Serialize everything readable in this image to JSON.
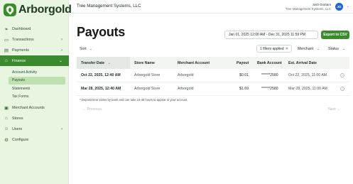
{
  "brand": {
    "name": "Arborgold"
  },
  "sidebar": {
    "items": [
      {
        "label": "Dashboard",
        "icon": "leaf-icon"
      },
      {
        "label": "Transactions",
        "icon": "card-icon",
        "chevron": "›"
      },
      {
        "label": "Payments",
        "icon": "wallet-icon",
        "chevron": "›"
      },
      {
        "label": "Finance",
        "icon": "bank-icon",
        "chevron": "⌄"
      },
      {
        "label": "Merchant Accounts",
        "icon": "id-card-icon"
      },
      {
        "label": "Stores",
        "icon": "store-icon"
      },
      {
        "label": "Users",
        "icon": "user-icon",
        "chevron": "›"
      },
      {
        "label": "Configure",
        "icon": "gear-icon"
      }
    ],
    "finance_subitems": [
      "Account Activity",
      "Payouts",
      "Statements",
      "Tax Forms"
    ]
  },
  "header": {
    "company": "Tree Management Systems, LLC",
    "user_name": "Josh Graham",
    "user_org": "Tree Management Systems, LLC",
    "avatar_initials": "JG"
  },
  "page": {
    "title": "Payouts",
    "date_range": "Jan 01, 2025 12:00 AM - Dec 31, 2025 11:59 PM",
    "export_label": "Export to CSV",
    "sort_label": "Sort",
    "filters_applied": "1 filters applied",
    "merchant_label": "Merchant",
    "status_label": "Status"
  },
  "table": {
    "columns": [
      "Transfer Date",
      "Store Name",
      "Merchant Account",
      "Payout",
      "Bank Account",
      "Est. Arrival Date"
    ],
    "rows": [
      {
        "date": "Oct 22, 2025, 12:40 AM",
        "store": "Arborgold Store",
        "merchant": "Arborgold",
        "payout": "$0.01",
        "bank": "******2580",
        "arrival": "Oct 22, 2025, 11:00 AM"
      },
      {
        "date": "Mar 28, 2025, 12:40 AM",
        "store": "Arborgold Store",
        "merchant": "Arborgold",
        "payout": "$1.69",
        "bank": "******2580",
        "arrival": "Mar 28, 2025, 11:00 AM"
      }
    ]
  },
  "footer": {
    "note": "* Deposit time varies by bank and can take 24-48 hours to appear in your account.",
    "prev_label": "← Previous",
    "next_label": "Next →"
  },
  "colors": {
    "brand_green": "#3c8a2e",
    "sidebar_bg": "#e8f5e0",
    "avatar_blue": "#1f66d1"
  }
}
